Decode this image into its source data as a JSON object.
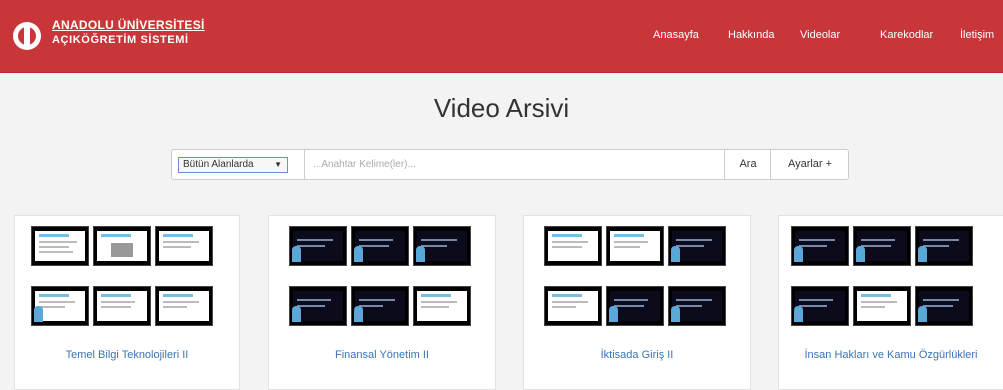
{
  "header": {
    "brand_line1": "ANADOLU ÜNİVERSİTESİ",
    "brand_line2": "AÇIKÖĞRETİM SİSTEMİ",
    "logo_icon": "anadolu-logo-icon",
    "accent_color": "#c8363a",
    "nav": [
      "Anasayfa",
      "Hakkında",
      "Videolar",
      "Karekodlar",
      "İletişim"
    ]
  },
  "main": {
    "title": "Video Arsivi",
    "search": {
      "scope_value": "Bütün Alanlarda",
      "placeholder": "...Anahtar Kelime(ler)...",
      "search_button": "Ara",
      "settings_button": "Ayarlar +"
    },
    "cards": [
      {
        "title": "Temel Bilgi Teknolojileri II"
      },
      {
        "title": "Finansal Yönetim II"
      },
      {
        "title": "İktisada Giriş II"
      },
      {
        "title": "İnsan Hakları ve Kamu Özgürlükleri"
      }
    ]
  }
}
